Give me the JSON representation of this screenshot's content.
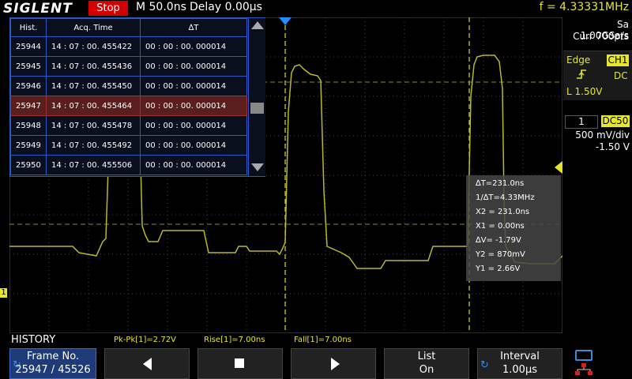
{
  "header": {
    "logo": "SIGLENT",
    "run_state": "Stop",
    "timebase": "M 50.0ns",
    "delay": "Delay 0.00µs",
    "frequency": "f = 4.33331MHz"
  },
  "acquisition": {
    "sample_rate": "Sa 1.00GSa/s",
    "memory": "Curr 700pts"
  },
  "trigger": {
    "mode": "Edge",
    "source": "CH1",
    "slope_icon": "rising-edge-icon",
    "coupling": "DC",
    "level": "L  1.50V"
  },
  "channel": {
    "number": "1",
    "coupling": "DC50",
    "scale": "500 mV/div",
    "offset": "-1.50 V"
  },
  "history_table": {
    "headers": [
      "Hist.",
      "Acq. Time",
      "∆T"
    ],
    "selected_index": 3,
    "rows": [
      [
        "25944",
        "14 : 07 : 00. 455422",
        "00 : 00 : 00. 000014"
      ],
      [
        "25945",
        "14 : 07 : 00. 455436",
        "00 : 00 : 00. 000014"
      ],
      [
        "25946",
        "14 : 07 : 00. 455450",
        "00 : 00 : 00. 000014"
      ],
      [
        "25947",
        "14 : 07 : 00. 455464",
        "00 : 00 : 00. 000014"
      ],
      [
        "25948",
        "14 : 07 : 00. 455478",
        "00 : 00 : 00. 000014"
      ],
      [
        "25949",
        "14 : 07 : 00. 455492",
        "00 : 00 : 00. 000014"
      ],
      [
        "25950",
        "14 : 07 : 00. 455506",
        "00 : 00 : 00. 000014"
      ]
    ]
  },
  "cursors": {
    "delta_t": "∆T=231.0ns",
    "inv_delta_t": "1/∆T=4.33MHz",
    "x2": "X2 = 231.0ns",
    "x1": "X1 = 0.00ns",
    "delta_v": "∆V= -1.79V",
    "y2": "Y2 = 870mV",
    "y1": "Y1 = 2.66V"
  },
  "mode_label": "HISTORY",
  "measurements": {
    "pkpk": "Pk-Pk[1]=2.72V",
    "rise": "Rise[1]=7.00ns",
    "fall": "Fall[1]=7.00ns"
  },
  "softkeys": {
    "frame_label": "Frame No.",
    "frame_value": "25947 / 45526",
    "list_label": "List",
    "list_value": "On",
    "interval_label": "Interval",
    "interval_value": "1.00µs"
  },
  "markers": {
    "ground_marker": "1"
  },
  "colors": {
    "trace": "#b8b82a",
    "accent_yellow": "#e6e62a",
    "stop_red": "#d40000",
    "table_border": "#2c58c8",
    "cursor_marker": "#1e90ff"
  }
}
